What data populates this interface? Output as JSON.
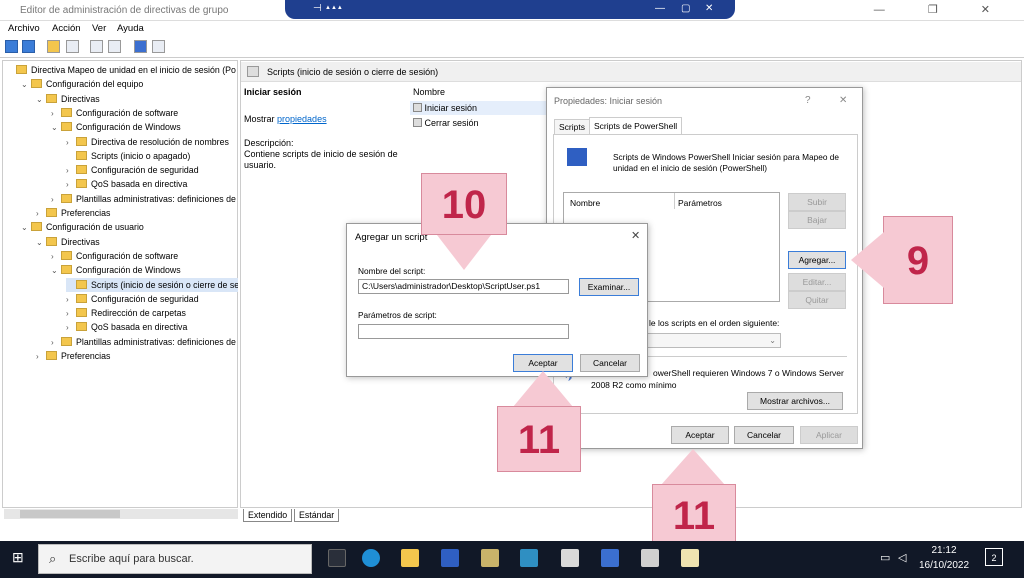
{
  "window": {
    "title": "Editor de administración de directivas de grupo",
    "controls": "— ❐ ✕"
  },
  "rdp": {
    "pin": "⊣",
    "signal": "▲▲▲",
    "min": "—",
    "restore": "▢",
    "close": "✕"
  },
  "menu": [
    "Archivo",
    "Acción",
    "Ver",
    "Ayuda"
  ],
  "tree": [
    {
      "label": "Directiva Mapeo de unidad en el inicio de sesión (Po",
      "indent": 0,
      "expander": ""
    },
    {
      "label": "Configuración del equipo",
      "indent": 1,
      "expander": "⌄"
    },
    {
      "label": "Directivas",
      "indent": 2,
      "expander": "⌄"
    },
    {
      "label": "Configuración de software",
      "indent": 3,
      "expander": "›"
    },
    {
      "label": "Configuración de Windows",
      "indent": 3,
      "expander": "⌄"
    },
    {
      "label": "Directiva de resolución de nombres",
      "indent": 4,
      "expander": "›"
    },
    {
      "label": "Scripts (inicio o apagado)",
      "indent": 4,
      "expander": ""
    },
    {
      "label": "Configuración de seguridad",
      "indent": 4,
      "expander": "›"
    },
    {
      "label": "QoS basada en directiva",
      "indent": 4,
      "expander": "›"
    },
    {
      "label": "Plantillas administrativas: definiciones de",
      "indent": 3,
      "expander": "›"
    },
    {
      "label": "Preferencias",
      "indent": 2,
      "expander": "›"
    },
    {
      "label": "Configuración de usuario",
      "indent": 1,
      "expander": "⌄"
    },
    {
      "label": "Directivas",
      "indent": 2,
      "expander": "⌄"
    },
    {
      "label": "Configuración de software",
      "indent": 3,
      "expander": "›"
    },
    {
      "label": "Configuración de Windows",
      "indent": 3,
      "expander": "⌄"
    },
    {
      "label": "Scripts (inicio de sesión o cierre de se",
      "indent": 4,
      "expander": ""
    },
    {
      "label": "Configuración de seguridad",
      "indent": 4,
      "expander": "›"
    },
    {
      "label": "Redirección de carpetas",
      "indent": 4,
      "expander": "›"
    },
    {
      "label": "QoS basada en directiva",
      "indent": 4,
      "expander": "›"
    },
    {
      "label": "Plantillas administrativas: definiciones de",
      "indent": 3,
      "expander": "›"
    },
    {
      "label": "Preferencias",
      "indent": 2,
      "expander": "›"
    }
  ],
  "content": {
    "header": "Scripts (inicio de sesión o cierre de sesión)",
    "section_title": "Iniciar sesión",
    "show_prefix": "Mostrar",
    "show_link": "propiedades",
    "desc_label": "Descripción:",
    "desc_text": "Contiene scripts de inicio de sesión de usuario.",
    "col_name": "Nombre",
    "items": [
      "Iniciar sesión",
      "Cerrar sesión"
    ],
    "tabs": [
      "Extendido",
      "Estándar"
    ]
  },
  "props_dialog": {
    "title": "Propiedades: Iniciar sesión",
    "help": "?",
    "close": "✕",
    "tabs": [
      "Scripts",
      "Scripts de PowerShell"
    ],
    "info": "Scripts de Windows PowerShell Iniciar sesión para Mapeo de unidad en el inicio de sesión (PowerShell)",
    "col_name": "Nombre",
    "col_params": "Parámetros",
    "btn_up": "Subir",
    "btn_down": "Bajar",
    "btn_add": "Agregar...",
    "btn_edit": "Editar...",
    "btn_remove": "Quitar",
    "order_label": "le los scripts en el orden siguiente:",
    "req_text_1": "owerShell requieren Windows 7 o Windows Server",
    "req_text_2": "2008 R2 como mínimo",
    "btn_show": "Mostrar archivos...",
    "btn_ok": "Aceptar",
    "btn_cancel": "Cancelar",
    "btn_apply": "Aplicar"
  },
  "add_dialog": {
    "title": "Agregar un script",
    "close": "✕",
    "name_label": "Nombre del script:",
    "name_value": "C:\\Users\\administrador\\Desktop\\ScriptUser.ps1",
    "btn_browse": "Examinar...",
    "params_label": "Parámetros de script:",
    "params_value": "",
    "btn_ok": "Aceptar",
    "btn_cancel": "Cancelar"
  },
  "callouts": [
    "10",
    "9",
    "11",
    "11"
  ],
  "taskbar": {
    "search_placeholder": "Escribe aquí para buscar.",
    "time": "21:12",
    "date": "16/10/2022",
    "notif": "2"
  }
}
